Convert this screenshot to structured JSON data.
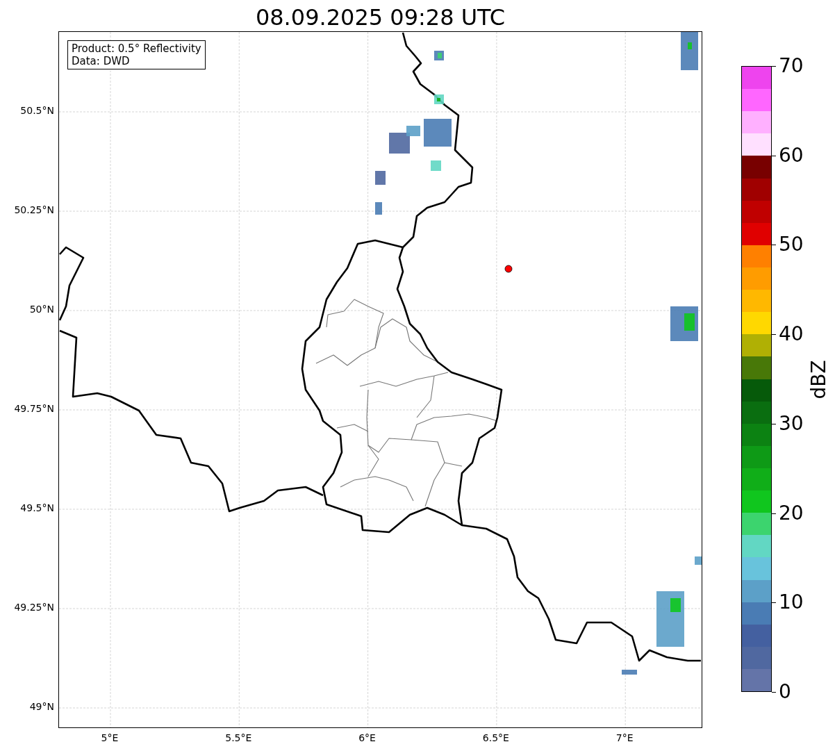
{
  "title": "08.09.2025 09:28 UTC",
  "map": {
    "info_box": [
      "Product: 0.5° Reflectivity",
      "Data: DWD"
    ],
    "lat_labels": [
      "50.5°N",
      "50.25°N",
      "50°N",
      "49.75°N",
      "49.5°N",
      "49.25°N",
      "49°N"
    ],
    "lon_labels": [
      "5°E",
      "5.5°E",
      "6°E",
      "6.5°E",
      "7°E"
    ]
  },
  "colorbar": {
    "label": "dBZ",
    "ticks": [
      "70",
      "60",
      "50",
      "40",
      "30",
      "20",
      "10",
      "0"
    ],
    "segments": [
      {
        "color": "#ee44ee"
      },
      {
        "color": "#ff66ff"
      },
      {
        "color": "#ffb0ff"
      },
      {
        "color": "#ffe0ff"
      },
      {
        "color": "#780000"
      },
      {
        "color": "#a00000"
      },
      {
        "color": "#c00000"
      },
      {
        "color": "#e00000"
      },
      {
        "color": "#ff8000"
      },
      {
        "color": "#ff9c00"
      },
      {
        "color": "#ffb800"
      },
      {
        "color": "#ffd800"
      },
      {
        "color": "#b0b004"
      },
      {
        "color": "#487808"
      },
      {
        "color": "#065a0a"
      },
      {
        "color": "#0a6e10"
      },
      {
        "color": "#0c8212"
      },
      {
        "color": "#0e9a16"
      },
      {
        "color": "#10ae18"
      },
      {
        "color": "#10c61e"
      },
      {
        "color": "#3cd46e"
      },
      {
        "color": "#62d7c3"
      },
      {
        "color": "#68c3dc"
      },
      {
        "color": "#5ca0c8"
      },
      {
        "color": "#4a7cb4"
      },
      {
        "color": "#4460a0"
      },
      {
        "color": "#5068a0"
      },
      {
        "color": "#6474a8"
      }
    ]
  }
}
